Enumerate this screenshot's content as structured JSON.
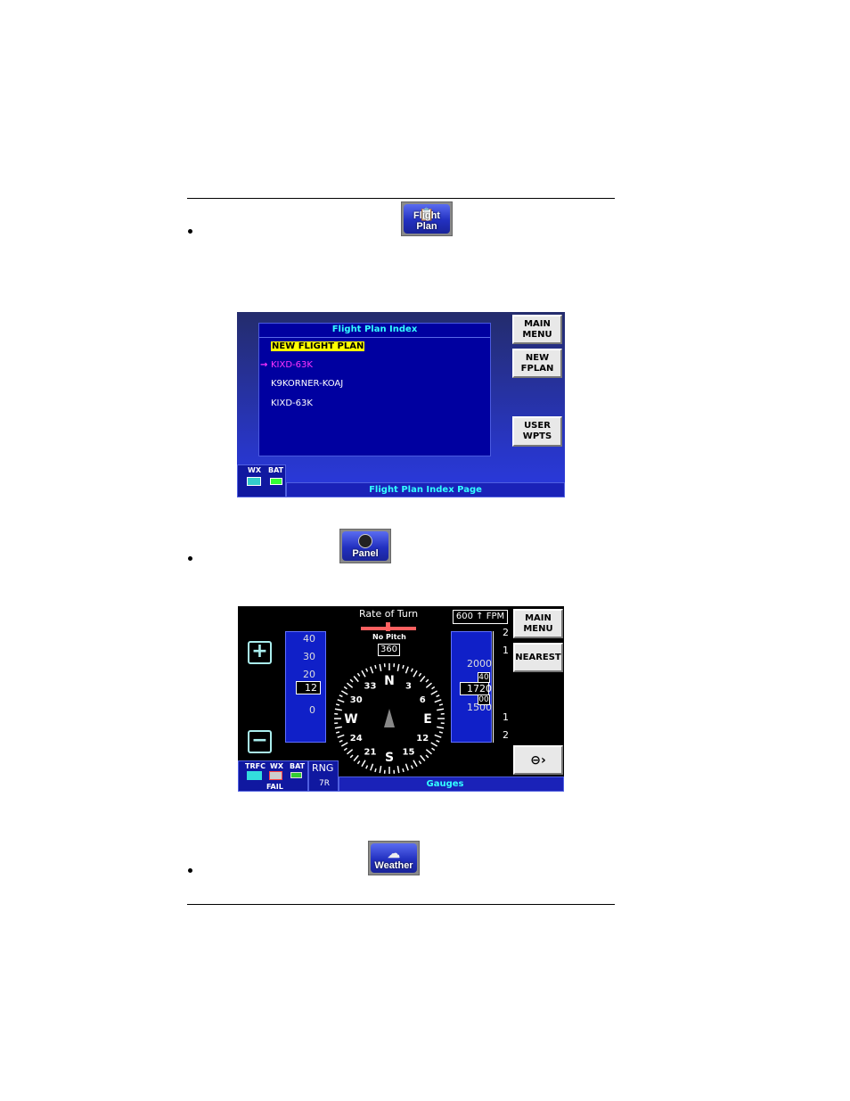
{
  "document": {
    "bullets": 3
  },
  "buttons": {
    "flight_plan": {
      "label": "Flight Plan",
      "icon": "flight-plan-icon"
    },
    "panel": {
      "label": "Panel",
      "icon": "clock-icon"
    },
    "weather": {
      "label": "Weather",
      "icon": "cloud-rain-icon"
    }
  },
  "flight_plan_screen": {
    "panel_title": "Flight Plan Index",
    "items": [
      {
        "label": "NEW FLIGHT PLAN",
        "state": "highlighted"
      },
      {
        "label": "KIXD-63K",
        "state": "active"
      },
      {
        "label": "K9KORNER-KOAJ",
        "state": "normal"
      },
      {
        "label": "KIXD-63K",
        "state": "normal"
      }
    ],
    "active_arrow": "→",
    "buttons": {
      "main_menu": "MAIN\nMENU",
      "new_fplan": "NEW\nFPLAN",
      "user_wpts": "USER\nWPTS"
    },
    "status": {
      "wx": "WX",
      "bat": "BAT"
    },
    "page_title": "Flight Plan Index Page"
  },
  "gauges_screen": {
    "rate_of_turn": "Rate of Turn",
    "pitch": "No Pitch",
    "heading": "360",
    "airspeed": {
      "ticks": [
        "40",
        "30",
        "20",
        "0"
      ],
      "current": "12"
    },
    "compass": {
      "cardinals": [
        "N",
        "E",
        "S",
        "W"
      ],
      "numbers": [
        "3",
        "6",
        "12",
        "15",
        "21",
        "24",
        "30",
        "33"
      ]
    },
    "vertical_speed": {
      "value": "600",
      "unit": "FPM",
      "arrow": "↑",
      "scale": [
        "2",
        "1",
        "1",
        "2"
      ]
    },
    "altitude": {
      "upper": "2000",
      "lower": "1500",
      "current_main": "17",
      "current_roll": "20",
      "roll_upper": "40",
      "roll_lower": "00"
    },
    "buttons": {
      "main_menu": "MAIN\nMENU",
      "nearest": "NEAREST",
      "zoom_in": "+",
      "zoom_out": "−",
      "exit": "⊖›"
    },
    "status": {
      "trfc": "TRFC",
      "wx": "WX",
      "bat": "BAT",
      "fail": "FAIL"
    },
    "range": {
      "label": "RNG",
      "value": "7R"
    },
    "page_title": "Gauges"
  },
  "colors": {
    "screen_blue": "#0000a8",
    "title_cyan": "#33ffff",
    "highlight_yellow": "#ffff00",
    "active_magenta": "#ff33ff",
    "turn_bar": "#ff6060"
  }
}
